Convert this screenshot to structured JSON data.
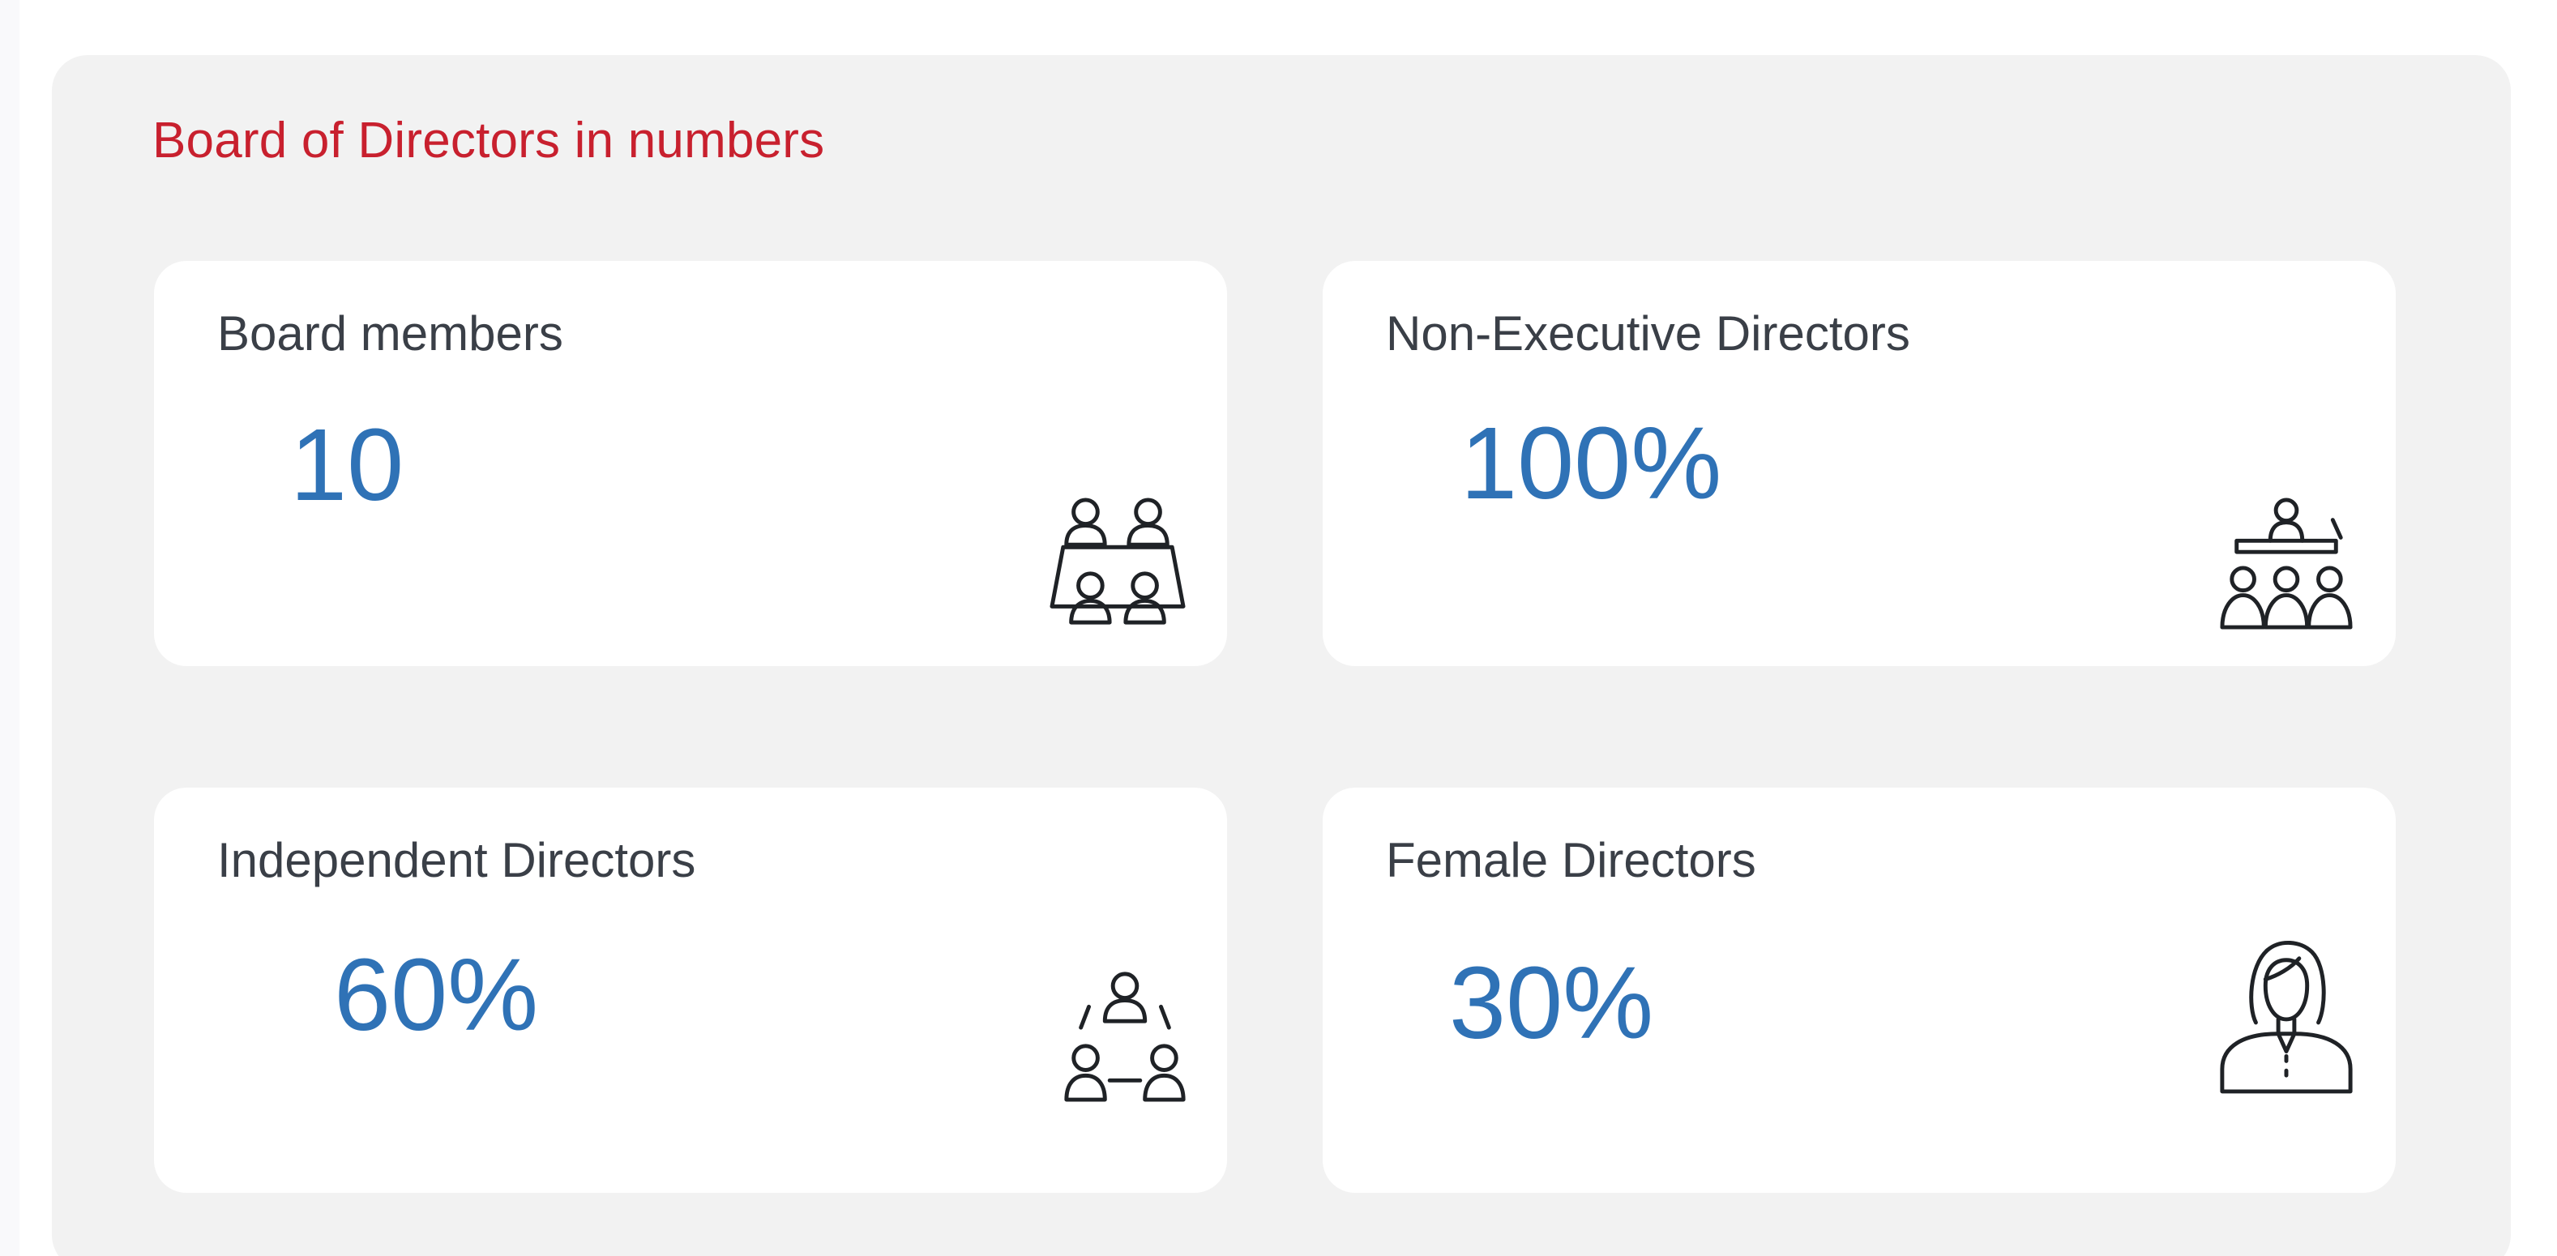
{
  "panel": {
    "title": "Board of Directors in numbers",
    "title_color": "#c8202e",
    "value_color": "#2f72b6",
    "cards": [
      {
        "label": "Board members",
        "value": "10",
        "icon": "board-table-icon"
      },
      {
        "label": "Non-Executive Directors",
        "value": "100%",
        "icon": "presenter-audience-icon"
      },
      {
        "label": "Independent Directors",
        "value": "60%",
        "icon": "people-network-icon"
      },
      {
        "label": "Female Directors",
        "value": "30%",
        "icon": "female-person-icon"
      }
    ]
  }
}
